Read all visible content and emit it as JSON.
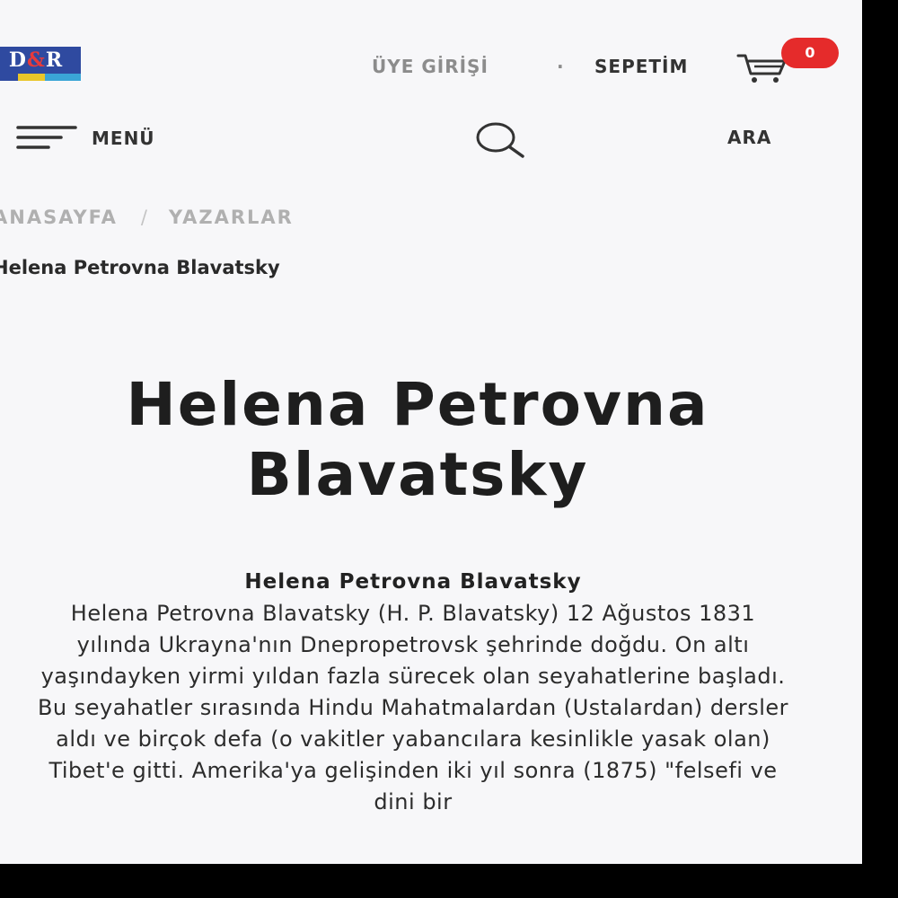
{
  "header": {
    "logo_text": "D&R",
    "member_login": "ÜYE GİRİŞİ",
    "separator": "·",
    "cart_label": "SEPETİM",
    "cart_count": "0",
    "menu_label": "MENÜ",
    "search_label": "ARA"
  },
  "breadcrumb": {
    "home": "ANASAYFA",
    "separator": "/",
    "authors": "YAZARLAR",
    "current": "Helena Petrovna Blavatsky"
  },
  "main": {
    "title": "Helena Petrovna Blavatsky",
    "bio_heading": "Helena Petrovna Blavatsky",
    "bio_text": "Helena Petrovna Blavatsky (H. P. Blavatsky) 12 Ağustos 1831 yılında Ukrayna'nın Dnepropetrovsk şehrinde doğdu. On altı yaşındayken yirmi yıldan fazla sürecek olan seyahatlerine başladı. Bu seyahatler sırasında Hindu Mahatmalardan (Ustalardan) dersler aldı ve birçok defa (o vakitler yabancılara kesinlikle yasak olan) Tibet'e gitti. Amerika'ya gelişinden iki yıl sonra (1875) \"felsefi ve dini bir"
  },
  "colors": {
    "badge": "#e52b2b",
    "logo_blue": "#2f4aa0",
    "muted_text": "#8c8c8c",
    "dark_text": "#1e1e1e"
  },
  "icons": {
    "cart": "cart-icon",
    "menu": "hamburger-menu-icon",
    "search": "search-icon"
  }
}
